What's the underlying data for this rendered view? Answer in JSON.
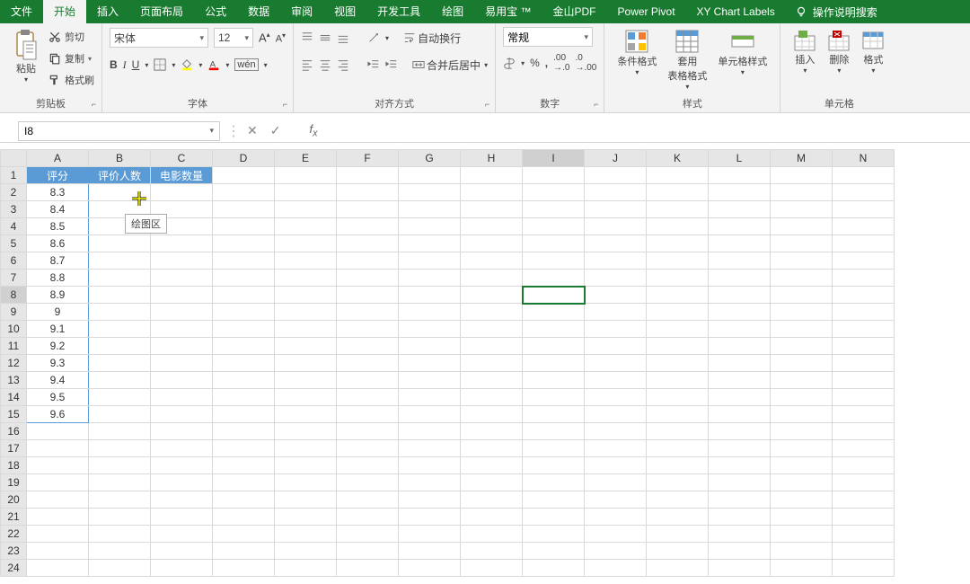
{
  "menu": {
    "tabs": [
      "文件",
      "开始",
      "插入",
      "页面布局",
      "公式",
      "数据",
      "审阅",
      "视图",
      "开发工具",
      "绘图",
      "易用宝 ™",
      "金山PDF",
      "Power Pivot",
      "XY Chart Labels"
    ],
    "active_index": 1,
    "tellme": "操作说明搜索"
  },
  "ribbon": {
    "clipboard": {
      "paste": "粘贴",
      "cut": "剪切",
      "copy": "复制",
      "format_painter": "格式刷",
      "label": "剪贴板"
    },
    "font": {
      "name": "宋体",
      "size": "12",
      "label": "字体"
    },
    "align": {
      "wrap": "自动换行",
      "merge": "合并后居中",
      "label": "对齐方式"
    },
    "number": {
      "format": "常规",
      "label": "数字"
    },
    "styles": {
      "cond": "条件格式",
      "table": "套用\n表格格式",
      "cell": "单元格样式",
      "label": "样式"
    },
    "cells": {
      "insert": "插入",
      "delete": "删除",
      "format": "格式",
      "label": "单元格"
    }
  },
  "namebox": {
    "ref": "I8"
  },
  "columns": [
    "A",
    "B",
    "C",
    "D",
    "E",
    "F",
    "G",
    "H",
    "I",
    "J",
    "K",
    "L",
    "M",
    "N"
  ],
  "row_count": 24,
  "headers": [
    "评分",
    "评价人数",
    "电影数量"
  ],
  "colA": [
    "8.3",
    "8.4",
    "8.5",
    "8.6",
    "8.7",
    "8.8",
    "8.9",
    "9",
    "9.1",
    "9.2",
    "9.3",
    "9.4",
    "9.5",
    "9.6"
  ],
  "tooltip": "绘图区",
  "selected": {
    "col": "I",
    "row": 8
  },
  "active_row": 8,
  "active_col_index": 8
}
